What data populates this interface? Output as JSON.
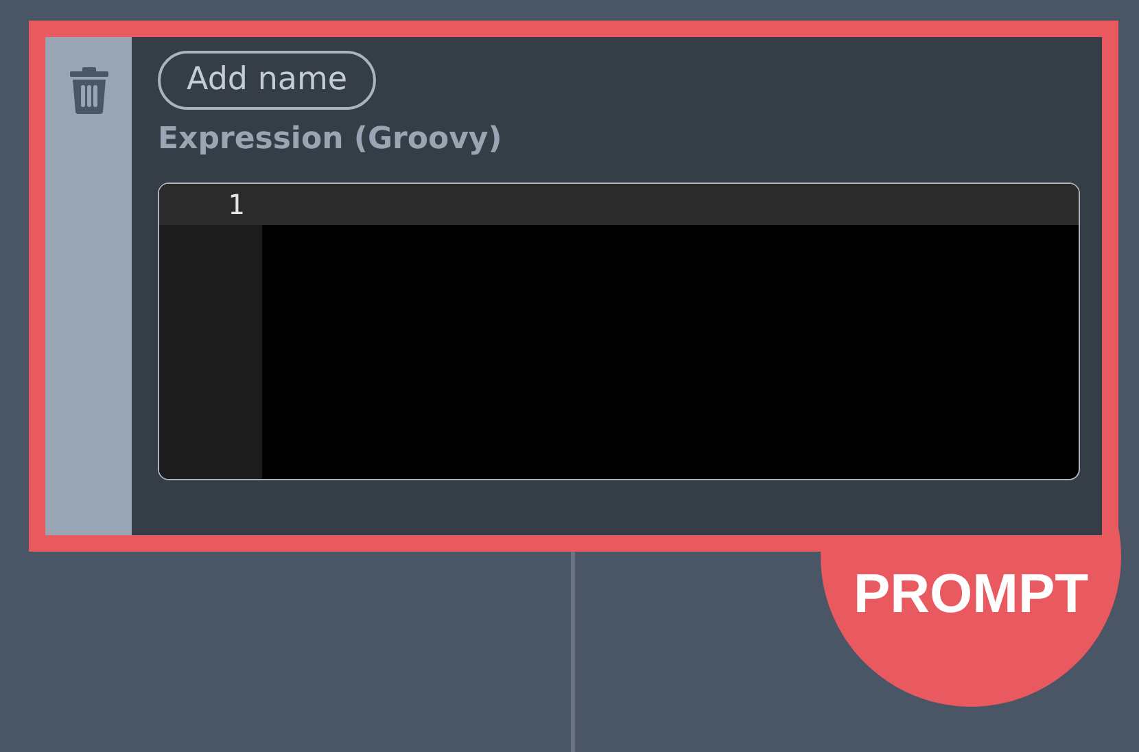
{
  "card": {
    "name_button": "Add name",
    "expression_label": "Expression (Groovy)",
    "editor": {
      "lines": [
        {
          "number": "1",
          "active": true
        }
      ]
    }
  },
  "badge": "PROMPT"
}
